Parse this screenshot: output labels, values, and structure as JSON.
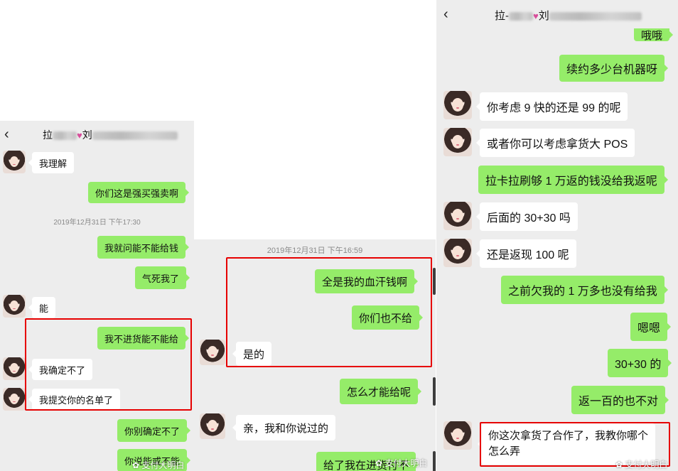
{
  "panel1": {
    "title_prefix": "拉",
    "title_name": "刘",
    "back_icon": "‹",
    "messages": [
      {
        "side": "left",
        "text": "我理解"
      },
      {
        "side": "right",
        "text": "你们这是强买强卖啊"
      },
      {
        "side": "time",
        "text": "2019年12月31日 下午17:30"
      },
      {
        "side": "right",
        "text": "我就问能不能给钱"
      },
      {
        "side": "right",
        "text": "气死我了"
      },
      {
        "side": "left",
        "text": "能"
      },
      {
        "side": "right",
        "text": "我不进货能不能给"
      },
      {
        "side": "left",
        "text": "我确定不了"
      },
      {
        "side": "left",
        "text": "我提交你的名单了"
      },
      {
        "side": "right",
        "text": "你别确定不了"
      },
      {
        "side": "right",
        "text": "你说能或不能"
      }
    ],
    "watermark": "支付大明白"
  },
  "panel2": {
    "messages": [
      {
        "side": "time",
        "text": "2019年12月31日 下午16:59"
      },
      {
        "side": "right",
        "text": "全是我的血汗钱啊"
      },
      {
        "side": "right",
        "text": "你们也不给"
      },
      {
        "side": "left",
        "text": "是的"
      },
      {
        "side": "right",
        "text": "怎么才能给呢"
      },
      {
        "side": "left",
        "text": "亲，我和你说过的"
      },
      {
        "side": "right",
        "text": "给了我在进货付不"
      }
    ],
    "watermark": "支付大明白"
  },
  "panel3": {
    "title_prefix": "拉-",
    "title_name": "刘",
    "back_icon": "‹",
    "messages": [
      {
        "side": "right",
        "text": "哦哦"
      },
      {
        "side": "right",
        "text": "续约多少台机器呀"
      },
      {
        "side": "left",
        "text": "你考虑 9 快的还是 99 的呢"
      },
      {
        "side": "left",
        "text": "或者你可以考虑拿货大 POS"
      },
      {
        "side": "right",
        "text": "拉卡拉刷够 1 万返的钱没给我返呢"
      },
      {
        "side": "left",
        "text": "后面的 30+30 吗"
      },
      {
        "side": "left",
        "text": "还是返现 100 呢"
      },
      {
        "side": "right",
        "text": "之前欠我的 1 万多也没有给我"
      },
      {
        "side": "right",
        "text": "嗯嗯"
      },
      {
        "side": "right",
        "text": "30+30 的"
      },
      {
        "side": "right",
        "text": "返一百的也不对"
      },
      {
        "side": "left",
        "text": "你这次拿货了合作了，我教你哪个\n怎么弄"
      }
    ],
    "watermark": "支付大明白"
  }
}
